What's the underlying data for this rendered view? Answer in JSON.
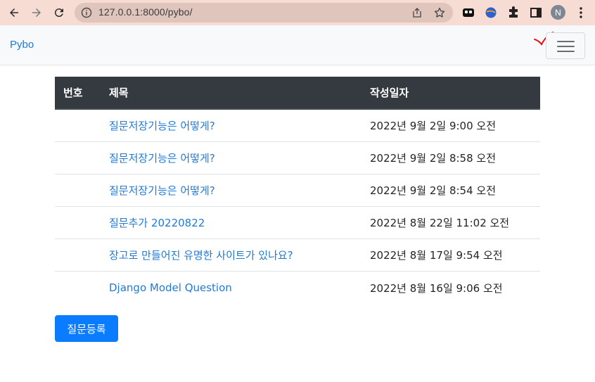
{
  "browser": {
    "url": "127.0.0.1:8000/pybo/",
    "profile_initial": "N",
    "icons": [
      "back-icon",
      "forward-icon",
      "reload-icon",
      "site-info-icon",
      "share-icon",
      "bookmark-star-icon",
      "extension-icon",
      "puzzle-icon",
      "sidepanel-icon",
      "menu-kebab-icon"
    ]
  },
  "navbar": {
    "brand": "Pybo"
  },
  "table": {
    "headers": [
      "번호",
      "제목",
      "작성일자"
    ],
    "rows": [
      {
        "number": "",
        "subject": "질문저장기능은 어떻게?",
        "date": "2022년 9월 2일 9:00 오전"
      },
      {
        "number": "",
        "subject": "질문저장기능은 어떻게?",
        "date": "2022년 9월 2일 8:58 오전"
      },
      {
        "number": "",
        "subject": "질문저장기능은 어떻게?",
        "date": "2022년 9월 2일 8:54 오전"
      },
      {
        "number": "",
        "subject": "질문추가 20220822",
        "date": "2022년 8월 22일 11:02 오전"
      },
      {
        "number": "",
        "subject": "장고로 만들어진 유명한 사이트가 있나요?",
        "date": "2022년 8월 17일 9:54 오전"
      },
      {
        "number": "",
        "subject": "Django Model Question",
        "date": "2022년 8월 16일 9:06 오전"
      }
    ]
  },
  "actions": {
    "add_question": "질문등록"
  },
  "colors": {
    "chrome_bg": "#f7dcd3",
    "link": "#1f7ad6",
    "header_bg": "#343a40",
    "primary_button": "#0a7cff"
  }
}
